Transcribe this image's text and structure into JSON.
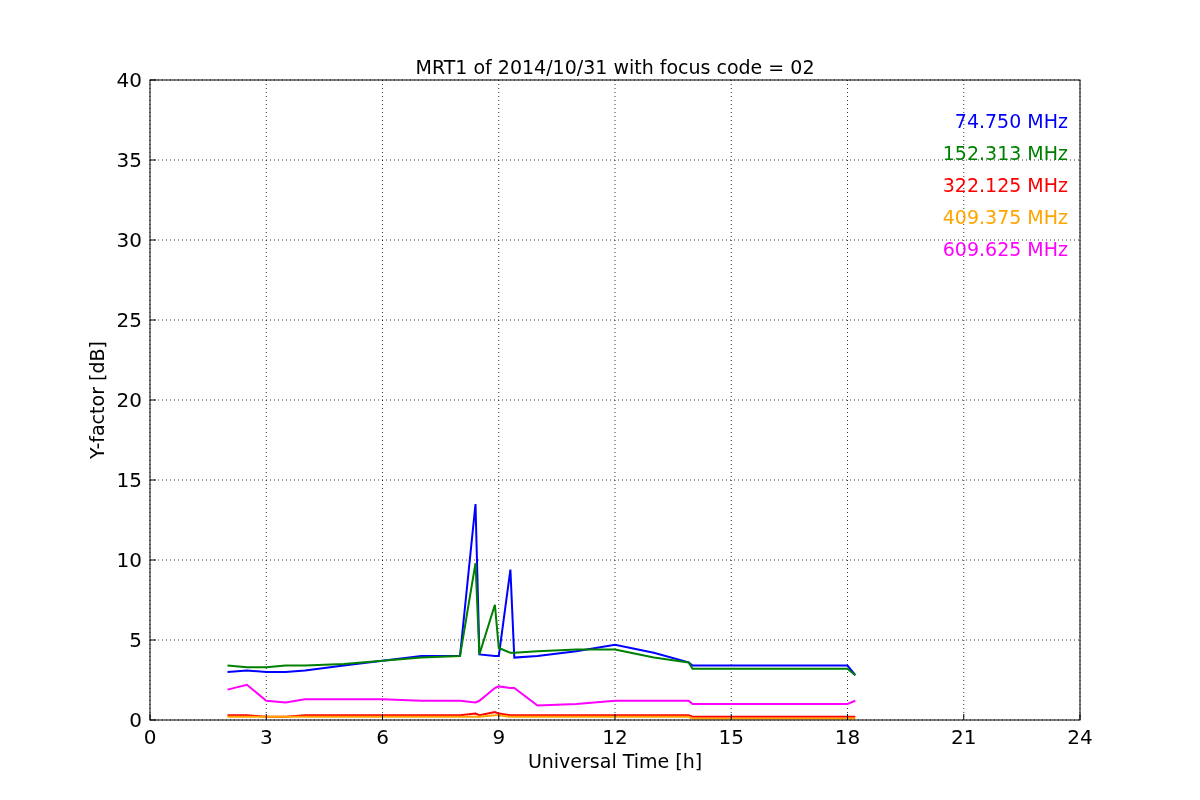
{
  "chart_data": {
    "type": "line",
    "title": "MRT1 of 2014/10/31 with focus code = 02",
    "xlabel": "Universal Time [h]",
    "ylabel": "Y-factor [dB]",
    "x": [
      2,
      2.5,
      3,
      3.5,
      4,
      5,
      6,
      7,
      8,
      8.4,
      8.5,
      8.9,
      9,
      9.3,
      9.4,
      10,
      11,
      12,
      13,
      13.9,
      14,
      18,
      18.2
    ],
    "series": [
      {
        "name": "74.750 MHz",
        "color": "#0000ff",
        "values": [
          3.0,
          3.1,
          3.0,
          3.0,
          3.1,
          3.4,
          3.7,
          4.0,
          4.0,
          13.5,
          4.1,
          4.0,
          4.0,
          9.4,
          3.9,
          4.0,
          4.3,
          4.7,
          4.2,
          3.6,
          3.4,
          3.4,
          2.8
        ]
      },
      {
        "name": "152.313 MHz",
        "color": "#008000",
        "values": [
          3.4,
          3.3,
          3.3,
          3.4,
          3.4,
          3.5,
          3.7,
          3.9,
          4.0,
          9.8,
          4.1,
          7.2,
          4.5,
          4.2,
          4.2,
          4.3,
          4.4,
          4.4,
          3.9,
          3.6,
          3.2,
          3.2,
          2.8
        ]
      },
      {
        "name": "322.125 MHz",
        "color": "#ff0000",
        "values": [
          0.3,
          0.3,
          0.2,
          0.2,
          0.3,
          0.3,
          0.3,
          0.3,
          0.3,
          0.4,
          0.3,
          0.5,
          0.4,
          0.3,
          0.3,
          0.3,
          0.3,
          0.3,
          0.3,
          0.3,
          0.2,
          0.2,
          0.2
        ]
      },
      {
        "name": "409.375 MHz",
        "color": "#ffa500",
        "values": [
          0.2,
          0.2,
          0.2,
          0.2,
          0.2,
          0.2,
          0.2,
          0.2,
          0.2,
          0.2,
          0.2,
          0.3,
          0.3,
          0.2,
          0.2,
          0.2,
          0.2,
          0.2,
          0.2,
          0.2,
          0.1,
          0.1,
          0.1
        ]
      },
      {
        "name": "609.625 MHz",
        "color": "#ff00ff",
        "values": [
          1.9,
          2.2,
          1.2,
          1.1,
          1.3,
          1.3,
          1.3,
          1.2,
          1.2,
          1.1,
          1.2,
          2.0,
          2.1,
          2.0,
          2.0,
          0.9,
          1.0,
          1.2,
          1.2,
          1.2,
          1.0,
          1.0,
          1.2
        ]
      }
    ],
    "xlim": [
      0,
      24
    ],
    "ylim": [
      0,
      40
    ],
    "xticks": [
      0,
      3,
      6,
      9,
      12,
      15,
      18,
      21,
      24
    ],
    "yticks": [
      0,
      5,
      10,
      15,
      20,
      25,
      30,
      35,
      40
    ],
    "grid": true
  }
}
